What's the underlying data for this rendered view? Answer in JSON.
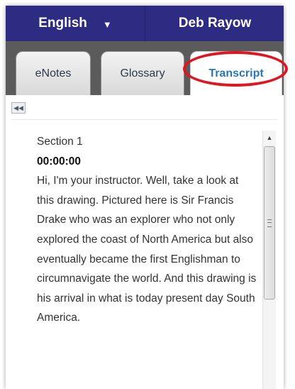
{
  "header": {
    "language": "English",
    "user": "Deb Rayow"
  },
  "tabs": [
    {
      "label": "eNotes"
    },
    {
      "label": "Glossary"
    },
    {
      "label": "Transcript",
      "active": true
    }
  ],
  "transcript": {
    "section": "Section 1",
    "timestamp": "00:00:00",
    "text": "Hi, I'm your instructor. Well, take a look at this drawing. Pictured here is Sir Francis Drake who was an explorer who not only explored the coast of North America but also eventually became the first Englishman to circumnavigate the world. And this drawing is his arrival in what is today present day South America."
  },
  "colors": {
    "header_bg": "#2e2c82",
    "tabstrip_bg": "#5b5b5b",
    "active_tab_text": "#2a77b8",
    "highlight_ring": "#e01520"
  },
  "icons": {
    "language_dropdown": "chevron-down-icon",
    "collapse": "double-left-arrow-icon",
    "scroll_up": "up-arrow-icon",
    "scroll_grip": "grip-icon"
  }
}
